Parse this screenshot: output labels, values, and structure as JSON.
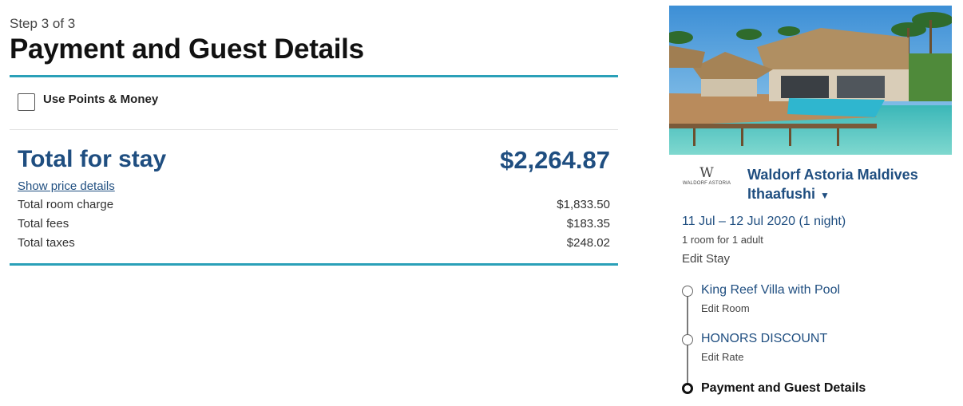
{
  "header": {
    "step_text": "Step 3 of 3",
    "title": "Payment and Guest Details"
  },
  "points_option": {
    "label": "Use Points & Money",
    "checked": false
  },
  "totals": {
    "label": "Total for stay",
    "amount": "$2,264.87",
    "show_details_link": "Show price details",
    "rows": [
      {
        "label": "Total room charge",
        "value": "$1,833.50"
      },
      {
        "label": "Total fees",
        "value": "$183.35"
      },
      {
        "label": "Total taxes",
        "value": "$248.02"
      }
    ]
  },
  "summary": {
    "hotel_name": "Waldorf Astoria Maldives Ithaafushi",
    "logo_text": "WALDORF ASTORIA",
    "dates": "11 Jul – 12 Jul 2020 (1 night)",
    "guests": "1 room for 1 adult",
    "edit_stay": "Edit Stay",
    "steps": [
      {
        "title": "King Reef Villa with Pool",
        "edit": "Edit Room"
      },
      {
        "title": "HONORS DISCOUNT",
        "edit": "Edit Rate"
      },
      {
        "title": "Payment and Guest Details",
        "edit": ""
      }
    ]
  },
  "colors": {
    "accent_rule": "#2aa0b8",
    "brand_blue": "#1f4e80"
  },
  "icons": {
    "logo": "waldorf-astoria-logo",
    "dropdown": "caret-down-icon"
  }
}
